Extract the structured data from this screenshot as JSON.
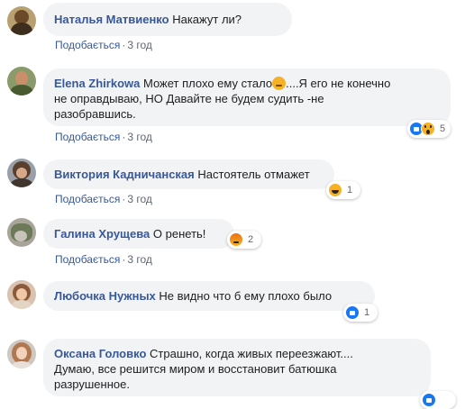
{
  "comments": [
    {
      "author": "Наталья Матвиенко",
      "text": "Накажут ли?",
      "like": "Подобається",
      "time": "3 год",
      "reaction_count": ""
    },
    {
      "author": "Elena Zhirkowa",
      "text_line1_before": "Может плохо ему стало",
      "text_line1_after": "....Я его не конечно",
      "text_line2": "не оправдываю, НО Давайте не будем судить -не",
      "text_line3": "разобравшись.",
      "like": "Подобається",
      "time": "3 год",
      "reaction_count": "5",
      "reactions": [
        "like-icon",
        "wow-icon"
      ]
    },
    {
      "author": "Виктория Кадничанская",
      "text": "Настоятель отмажет",
      "like": "Подобається",
      "time": "3 год",
      "reaction_count": "1",
      "reactions": [
        "haha-icon"
      ]
    },
    {
      "author": "Галина Хрущева",
      "text": "О  ренеть!",
      "like": "Подобається",
      "time": "3 год",
      "reaction_count": "2",
      "reactions": [
        "angry-icon"
      ]
    },
    {
      "author": "Любочка Нужных",
      "text": "Не видно что б ему плохо было",
      "like": "Подобається",
      "time": "3 год",
      "reaction_count": "1",
      "reactions": [
        "like-icon"
      ]
    },
    {
      "author": "Оксана Головко",
      "text_line1": "Страшно, когда живых переезжают....",
      "text_line2": "Думаю, все решится миром и восстановит батюшка",
      "text_line3": "разрушенное.",
      "like": "",
      "time": "",
      "reaction_count": "",
      "reactions": [
        "like-icon"
      ]
    }
  ],
  "separator": "·",
  "colors": {
    "author": "#385898",
    "bubble": "#f2f3f5",
    "meta": "#606770",
    "like_reaction": "#1877f2",
    "emoji_yellow": "#f7b125"
  }
}
